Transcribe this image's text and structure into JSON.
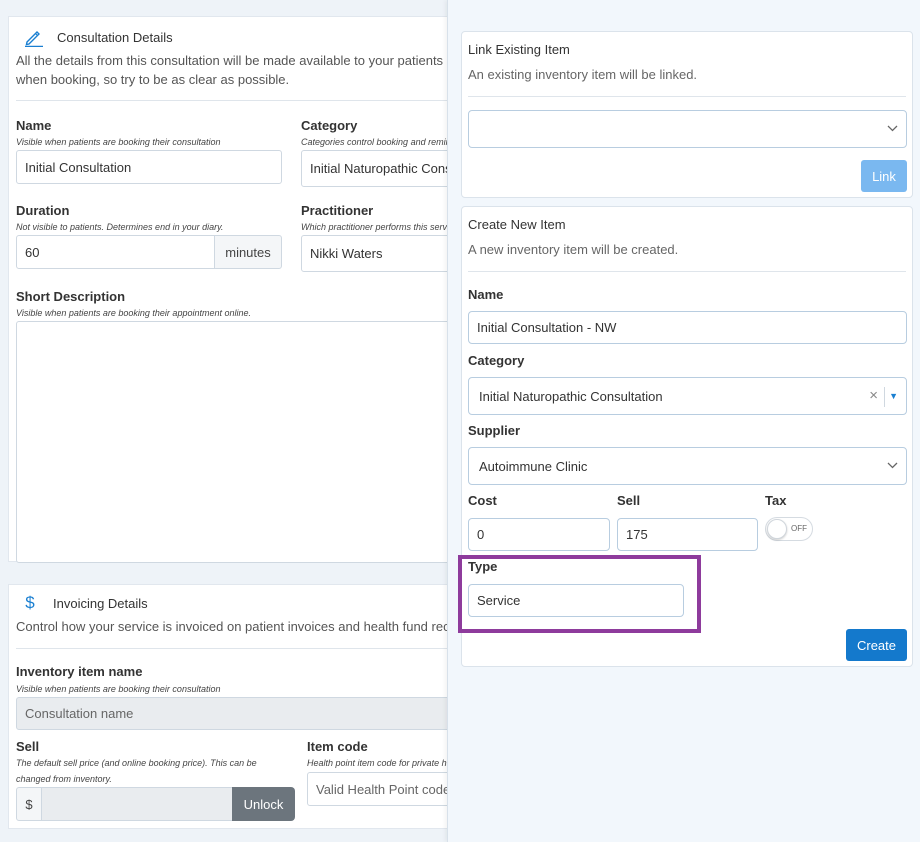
{
  "consultation": {
    "title": "Consultation Details",
    "description": "All the details from this consultation will be made available to your patients when booking, so try to be as clear as possible.",
    "name_label": "Name",
    "name_hint": "Visible when patients are booking their consultation",
    "name_value": "Initial Consultation",
    "category_label": "Category",
    "category_hint": "Categories control booking and reminders",
    "category_value": "Initial Naturopathic Consultation",
    "duration_label": "Duration",
    "duration_hint": "Not visible to patients. Determines end in your diary.",
    "duration_value": "60",
    "duration_unit": "minutes",
    "practitioner_label": "Practitioner",
    "practitioner_hint": "Which practitioner performs this service",
    "practitioner_value": "Nikki Waters",
    "short_desc_label": "Short Description",
    "short_desc_hint": "Visible when patients are booking their appointment online."
  },
  "invoicing": {
    "title": "Invoicing Details",
    "description": "Control how your service is invoiced on patient invoices and health fund receipts.",
    "inv_name_label": "Inventory item name",
    "inv_name_hint": "Visible when patients are booking their consultation",
    "inv_name_placeholder": "Consultation name",
    "sell_label": "Sell",
    "sell_hint_1": "The default sell price (and online booking price). This can be",
    "sell_hint_2": "changed from inventory.",
    "currency": "$",
    "unlock_label": "Unlock",
    "item_code_label": "Item code",
    "item_code_hint": "Health point item code for private health funds",
    "item_code_placeholder": "Valid Health Point code"
  },
  "link_existing": {
    "title": "Link Existing Item",
    "subtitle": "An existing inventory item will be linked.",
    "select_value": "",
    "link_button": "Link"
  },
  "create_new": {
    "title": "Create New Item",
    "subtitle": "A new inventory item will be created.",
    "name_label": "Name",
    "name_value": "Initial Consultation - NW",
    "category_label": "Category",
    "category_value": "Initial Naturopathic Consultation",
    "supplier_label": "Supplier",
    "supplier_value": "Autoimmune Clinic",
    "cost_label": "Cost",
    "cost_value": "0",
    "sell_label": "Sell",
    "sell_value": "175",
    "tax_label": "Tax",
    "tax_state": "OFF",
    "type_label": "Type",
    "type_value": "Service",
    "create_button": "Create"
  },
  "colors": {
    "accent": "#1a7fd1",
    "create_button": "#1479cc",
    "link_button": "#7ab8f0",
    "highlight": "#8e3b9c"
  },
  "icons": {
    "consultation": "pencil-icon",
    "invoicing": "dollar-icon",
    "dropdown": "chevron-down-icon",
    "clear": "close-icon",
    "dropdown_arrow": "caret-down-icon"
  }
}
